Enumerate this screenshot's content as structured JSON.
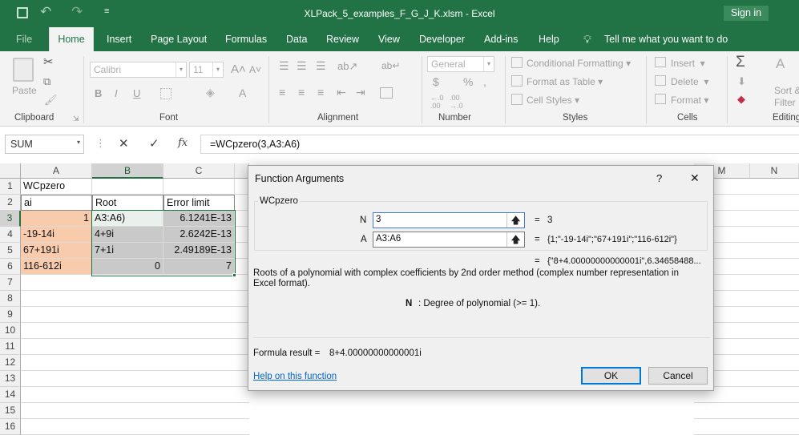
{
  "title": "XLPack_5_examples_F_G_J_K.xlsm  -  Excel",
  "sign_in": "Sign in",
  "quick_access": [
    "save-icon",
    "undo-icon",
    "redo-icon",
    "customize-icon"
  ],
  "tabs": [
    "File",
    "Home",
    "Insert",
    "Page Layout",
    "Formulas",
    "Data",
    "Review",
    "View",
    "Developer",
    "Add-ins",
    "Help"
  ],
  "tell_me": "Tell me what you want to do",
  "ribbon": {
    "clipboard": {
      "paste": "Paste",
      "label": "Clipboard"
    },
    "font": {
      "name": "Calibri",
      "size": "11",
      "bold": "B",
      "italic": "I",
      "underline": "U",
      "label": "Font"
    },
    "alignment": {
      "label": "Alignment"
    },
    "number": {
      "format": "General",
      "label": "Number"
    },
    "styles": {
      "conditional": "Conditional Formatting",
      "table": "Format as Table",
      "cell": "Cell Styles",
      "label": "Styles"
    },
    "cells": {
      "insert": "Insert",
      "delete": "Delete",
      "format": "Format",
      "label": "Cells"
    },
    "editing": {
      "sort": "Sort &",
      "filter": "Filter",
      "label": "Editing"
    }
  },
  "formula_bar": {
    "name_box": "SUM",
    "fx": "fx",
    "formula": "=WCpzero(3,A3:A6)"
  },
  "columns": [
    "A",
    "B",
    "C",
    "M",
    "N"
  ],
  "rows": [
    "1",
    "2",
    "3",
    "4",
    "5",
    "6",
    "7",
    "8",
    "9",
    "10",
    "11",
    "12",
    "13",
    "14",
    "15",
    "16"
  ],
  "cells": {
    "A1": "WCpzero",
    "A2": "ai",
    "B2": "Root",
    "C2": "Error limit",
    "A3": "1",
    "B3": "A3:A6)",
    "C3": "6.1241E-13",
    "A4": "-19-14i",
    "B4": "4+9i",
    "C4": "2.6242E-13",
    "A5": "67+191i",
    "B5": "7+1i",
    "C5": "2.49189E-13",
    "A6": "116-612i",
    "B6": "0",
    "C6": "7"
  },
  "dialog": {
    "title": "Function Arguments",
    "help": "?",
    "close": "✕",
    "function_name": "WCpzero",
    "args": [
      {
        "name": "N",
        "value": "3",
        "result": "3"
      },
      {
        "name": "A",
        "value": "A3:A6",
        "result": "{1;\"-19-14i\";\"67+191i\";\"116-612i\"}"
      }
    ],
    "eq": "=",
    "overall_result": "{\"8+4.00000000000001i\",6.34658488...",
    "description": "Roots of a polynomial with complex coefficients by 2nd order method (complex number representation in Excel format).",
    "arg_help_name": "N",
    "arg_help_text": ": Degree of polynomial (>= 1).",
    "formula_result_label": "Formula result =",
    "formula_result": "8+4.00000000000001i",
    "help_link": "Help on this function",
    "ok": "OK",
    "cancel": "Cancel"
  }
}
